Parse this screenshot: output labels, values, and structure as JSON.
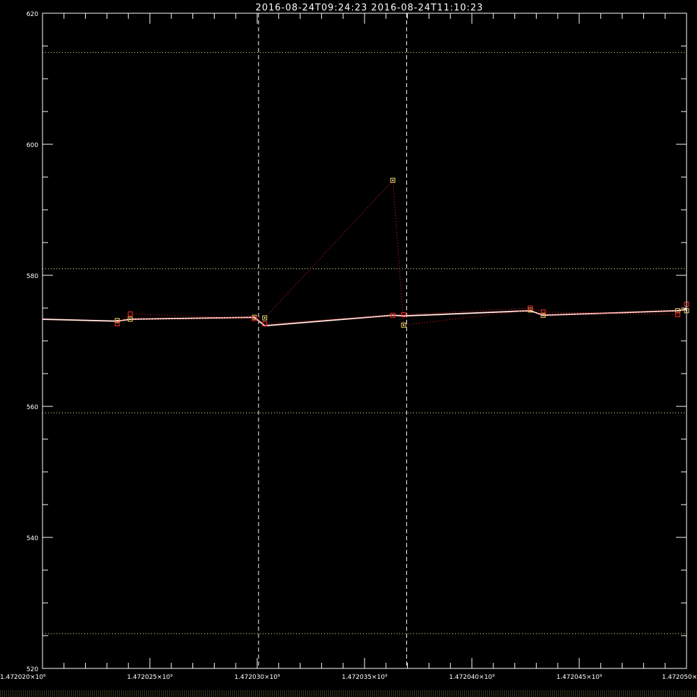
{
  "colors": {
    "background": "#000000",
    "axis": "#ffffff",
    "series_primary": "#ffffff",
    "series_secondary": "#ff2020",
    "marker_yellow": "#ffe060",
    "marker_red": "#ff3030"
  },
  "chart_data": {
    "type": "line",
    "title": "2016-08-24T09:24:23  2016-08-24T11:10:23",
    "xlabel": "",
    "ylabel": "",
    "xlim": [
      1472020000,
      1472050000
    ],
    "ylim": [
      520,
      620
    ],
    "x_tick_labels": [
      {
        "value": 1472020000,
        "label": "1.472020×10⁹"
      },
      {
        "value": 1472025000,
        "label": "1.472025×10⁹"
      },
      {
        "value": 1472030000,
        "label": "1.472030×10⁹"
      },
      {
        "value": 1472035000,
        "label": "1.472035×10⁹"
      },
      {
        "value": 1472040000,
        "label": "1.472040×10⁹"
      },
      {
        "value": 1472045000,
        "label": "1.472045×10⁹"
      },
      {
        "value": 1472050000,
        "label": "1.472050×"
      }
    ],
    "y_tick_labels": [
      {
        "value": 520,
        "label": "520"
      },
      {
        "value": 540,
        "label": "540"
      },
      {
        "value": 560,
        "label": "560"
      },
      {
        "value": 580,
        "label": "580"
      },
      {
        "value": 600,
        "label": "600"
      },
      {
        "value": 620,
        "label": "620"
      }
    ],
    "vertical_dashed_lines": [
      1472030063,
      1472036963
    ],
    "horizontal_dotted_lines": [
      614,
      581,
      559,
      525.3
    ],
    "series": [
      {
        "style": "solid-white",
        "x": [
          1472020000,
          1472023480,
          1472024090,
          1472029870,
          1472030350,
          1472036320,
          1472036820,
          1472042720,
          1472043320,
          1472049590,
          1472050000
        ],
        "y": [
          573.3,
          573.0,
          573.3,
          573.6,
          572.3,
          573.9,
          573.8,
          574.6,
          573.9,
          574.6,
          574.8
        ]
      },
      {
        "style": "dotted-red-yellow-markers",
        "x": [
          1472023480,
          1472024090,
          1472029870,
          1472030350,
          1472036320,
          1472036820,
          1472042720,
          1472043320,
          1472049590,
          1472050000
        ],
        "y": [
          573.1,
          573.3,
          573.6,
          573.5,
          594.5,
          572.4,
          574.7,
          573.9,
          574.6,
          574.6
        ]
      },
      {
        "style": "dotted-red-red-markers",
        "x": [
          1472023480,
          1472024090,
          1472029870,
          1472030350,
          1472036320,
          1472036820,
          1472042720,
          1472043320,
          1472049590,
          1472050000
        ],
        "y": [
          572.6,
          574.1,
          573.4,
          572.6,
          573.9,
          574.0,
          575.0,
          574.4,
          574.0,
          575.6
        ]
      }
    ]
  }
}
